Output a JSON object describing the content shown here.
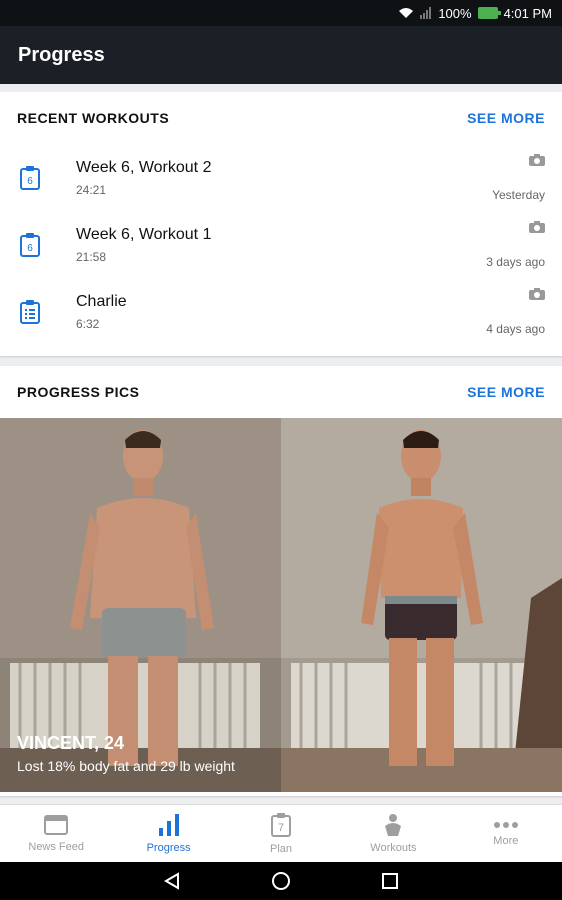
{
  "status": {
    "battery": "100%",
    "time": "4:01 PM"
  },
  "appbar": {
    "title": "Progress"
  },
  "recent": {
    "title": "RECENT WORKOUTS",
    "see_more": "SEE MORE",
    "items": [
      {
        "title": "Week 6, Workout 2",
        "duration": "24:21",
        "date": "Yesterday",
        "badge": "6"
      },
      {
        "title": "Week 6, Workout 1",
        "duration": "21:58",
        "date": "3 days ago",
        "badge": "6"
      },
      {
        "title": "Charlie",
        "duration": "6:32",
        "date": "4 days ago",
        "badge": ""
      }
    ]
  },
  "pics": {
    "title": "PROGRESS PICS",
    "see_more": "SEE MORE",
    "name": "VINCENT, 24",
    "caption": "Lost 18% body fat and 29 lb weight"
  },
  "nav": {
    "items": [
      {
        "label": "News Feed",
        "icon": "news-feed-icon"
      },
      {
        "label": "Progress",
        "icon": "progress-icon"
      },
      {
        "label": "Plan",
        "icon": "plan-icon"
      },
      {
        "label": "Workouts",
        "icon": "workouts-icon"
      },
      {
        "label": "More",
        "icon": "more-icon"
      }
    ],
    "plan_badge": "7"
  },
  "colors": {
    "accent": "#1e73d8",
    "appbar": "#1b1f26"
  }
}
